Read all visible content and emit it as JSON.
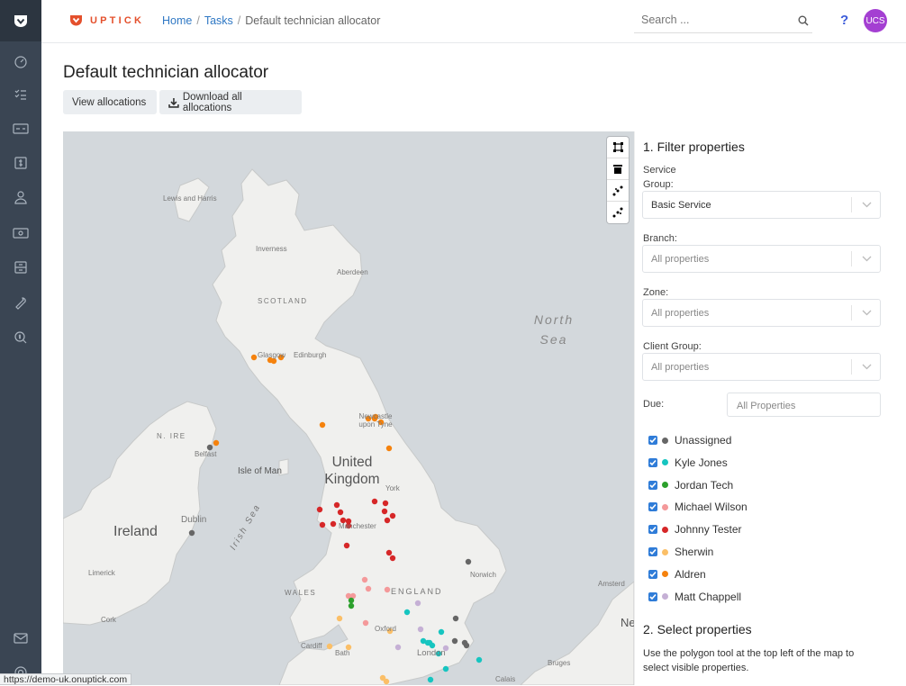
{
  "app": {
    "brand": "UPTICK",
    "brand_color": "#e4502c"
  },
  "breadcrumb": {
    "home": "Home",
    "tasks": "Tasks",
    "current": "Default technician allocator"
  },
  "search": {
    "placeholder": "Search ..."
  },
  "help_label": "?",
  "avatar": {
    "initials": "UCS",
    "color": "#a43fd2"
  },
  "page": {
    "title": "Default technician allocator",
    "buttons": {
      "view": "View allocations",
      "download": "Download all allocations"
    }
  },
  "sidebar_icons": [
    "uptick-logo-icon",
    "dashboard-icon",
    "tasks-icon",
    "invoices-icon",
    "quotes-icon",
    "users-icon",
    "billing-icon",
    "properties-icon",
    "tools-icon",
    "search-money-icon",
    "mail-icon",
    "settings-icon"
  ],
  "map": {
    "labels": {
      "lewis": "Lewis and Harris",
      "inverness": "Inverness",
      "aberdeen": "Aberdeen",
      "scotland": "SCOTLAND",
      "glasgow": "Glasgow",
      "edinburgh": "Edinburgh",
      "newcastle": "Newcastle upon Tyne",
      "nire": "N. IRE",
      "belfast": "Belfast",
      "isleofman": "Isle of Man",
      "uk": "United Kingdom",
      "york": "York",
      "dublin": "Dublin",
      "ireland": "Ireland",
      "irishsea": "Irish Sea",
      "manchester": "Manchester",
      "limerick": "Limerick",
      "wales": "WALES",
      "england": "ENGLAND",
      "norwich": "Norwich",
      "amsterdam": "Amsterd",
      "cork": "Cork",
      "oxford": "Oxford",
      "cardiff": "Cardiff",
      "bath": "Bath",
      "london": "London",
      "bruges": "Bruges",
      "calais": "Calais",
      "ne": "Ne",
      "northsea": "North Sea"
    },
    "draw_tools": [
      "polygon-tool-icon",
      "delete-tool-icon",
      "combine-tool-icon",
      "uncombine-tool-icon"
    ]
  },
  "filters": {
    "title": "1. Filter properties",
    "service_group_label": "Service Group:",
    "service_group_value": "Basic Service",
    "branch_label": "Branch:",
    "branch_placeholder": "All properties",
    "zone_label": "Zone:",
    "zone_placeholder": "All properties",
    "client_group_label": "Client Group:",
    "client_group_placeholder": "All properties",
    "due_label": "Due:",
    "due_placeholder": "All Properties"
  },
  "technicians": [
    {
      "name": "Unassigned",
      "color": "#666666",
      "checked": true
    },
    {
      "name": "Kyle Jones",
      "color": "#16c5c0",
      "checked": true
    },
    {
      "name": "Jordan Tech",
      "color": "#2ca02c",
      "checked": true
    },
    {
      "name": "Michael Wilson",
      "color": "#f4999a",
      "checked": true
    },
    {
      "name": "Johnny Tester",
      "color": "#d62728",
      "checked": true
    },
    {
      "name": "Sherwin",
      "color": "#fbbf67",
      "checked": true
    },
    {
      "name": "Aldren",
      "color": "#f5820d",
      "checked": true
    },
    {
      "name": "Matt Chappell",
      "color": "#c5b0d5",
      "checked": true
    }
  ],
  "select": {
    "title": "2. Select properties",
    "description": "Use the polygon tool at the top left of the map to select visible properties."
  },
  "status_url": "https://demo-uk.onuptick.com"
}
